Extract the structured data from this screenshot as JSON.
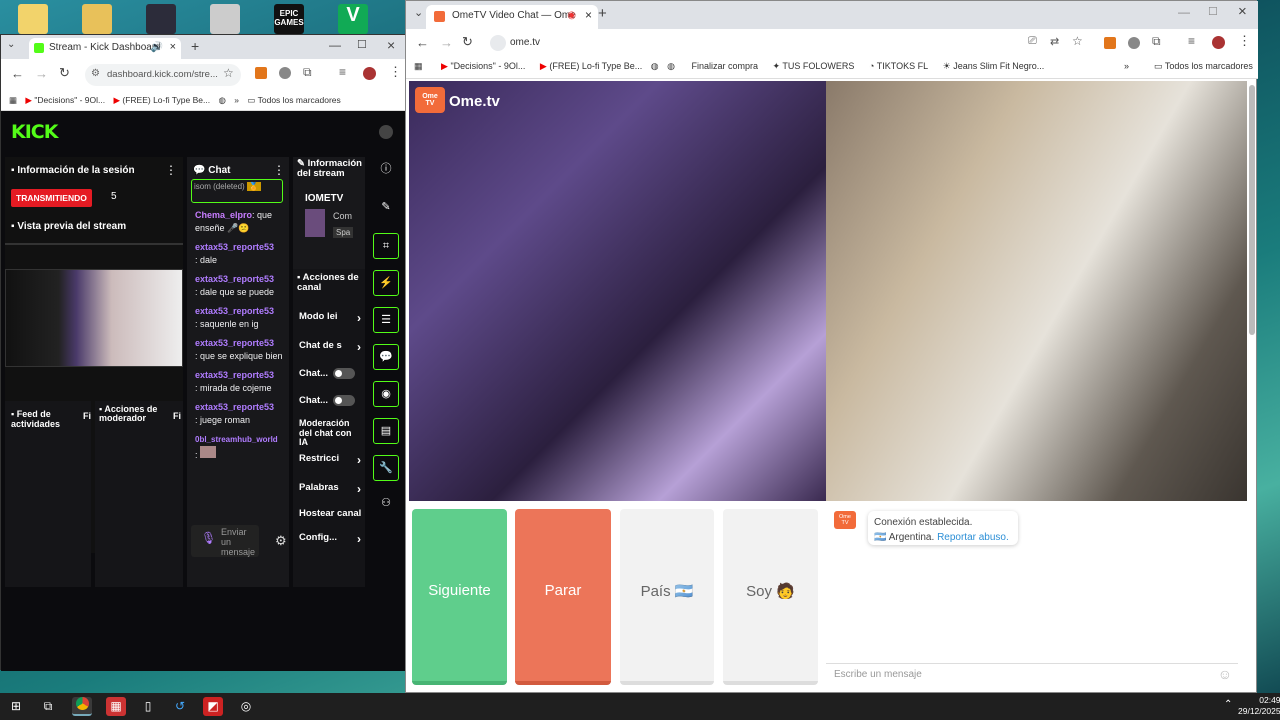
{
  "desktop": {
    "icons": [
      {
        "name": "desktop-icon-1",
        "color": "#f2d36b"
      },
      {
        "name": "desktop-icon-2",
        "color": "#e8c15a"
      },
      {
        "name": "desktop-icon-3",
        "color": "#334"
      },
      {
        "name": "desktop-icon-4",
        "color": "#ccc"
      },
      {
        "name": "epic-games-icon",
        "label": "EPIC GAMES",
        "color": "#111"
      },
      {
        "name": "gta-icon",
        "label": "V",
        "color": "#2a6"
      }
    ]
  },
  "left_browser": {
    "tab_title": "Stream - Kick Dashboard",
    "url": "dashboard.kick.com/stre...",
    "bookmarks": [
      "\"Decisions\" - 9Ol...",
      "(FREE) Lo-fi Type Be...",
      "Todos los marcadores"
    ]
  },
  "kick": {
    "logo": "KICK",
    "session": {
      "title": "Información de la sesión",
      "status": "TRANSMITIENDO",
      "viewers": "5",
      "preview_title": "Vista previa del stream"
    },
    "chat": {
      "title": "Chat",
      "top_partial": "isom (deleted)",
      "messages": [
        {
          "user": "Chema_elpro",
          "text": ": que enseñe 🎤😕"
        },
        {
          "user": "extax53_reporte53",
          "text": ": dale"
        },
        {
          "user": "extax53_reporte53",
          "text": ": dale que se puede"
        },
        {
          "user": "extax53_reporte53",
          "text": ": saquenle en ig"
        },
        {
          "user": "extax53_reporte53",
          "text": ": que se explique bien"
        },
        {
          "user": "extax53_reporte53",
          "text": ": mirada de cojeme"
        },
        {
          "user": "extax53_reporte53",
          "text": ": juege roman"
        },
        {
          "user": "0bl_streamhub_world",
          "text": ":"
        }
      ],
      "input_placeholder": "Enviar un mensaje"
    },
    "stream_info": {
      "title": "Información del stream",
      "name": "IOMETV",
      "line1": "Com",
      "line2": "Spa"
    },
    "channel_actions": {
      "title": "Acciones de canal",
      "items": [
        "Modo lei",
        "Chat de s",
        "Chat...",
        "Chat...",
        "Moderación del chat con IA",
        "Restricci",
        "Palabras",
        "Hostear canal",
        "Config..."
      ]
    },
    "activity_feed": "Feed de actividades",
    "activity_feed_badge": "Fi",
    "mod_actions": "Acciones de moderador",
    "mod_actions_badge": "Fi"
  },
  "right_browser": {
    "tab_title": "OmeTV Video Chat — Ome",
    "url": "ome.tv",
    "bookmarks": [
      "\"Decisions\" - 9Ol...",
      "(FREE) Lo-fi Type Be...",
      "Finalizar compra",
      "TUS FOLOWERS",
      "TIKTOKS FL",
      "Jeans Slim Fit Negro...",
      "Todos los marcadores"
    ]
  },
  "ometv": {
    "logo": "Ome.tv",
    "buttons": {
      "next": "Siguiente",
      "stop": "Parar",
      "country": "País 🇦🇷",
      "me": "Soy 🧑"
    },
    "colors": {
      "next": "#5fce8c",
      "stop": "#ec7559",
      "neutral": "#f2f2f2"
    },
    "system_message": {
      "line1": "Conexión establecida.",
      "country": "Argentina.",
      "report": "Reportar abuso."
    },
    "input_placeholder": "Escribe un mensaje"
  },
  "taskbar": {
    "time": "02:49",
    "date": "29/12/2025"
  }
}
